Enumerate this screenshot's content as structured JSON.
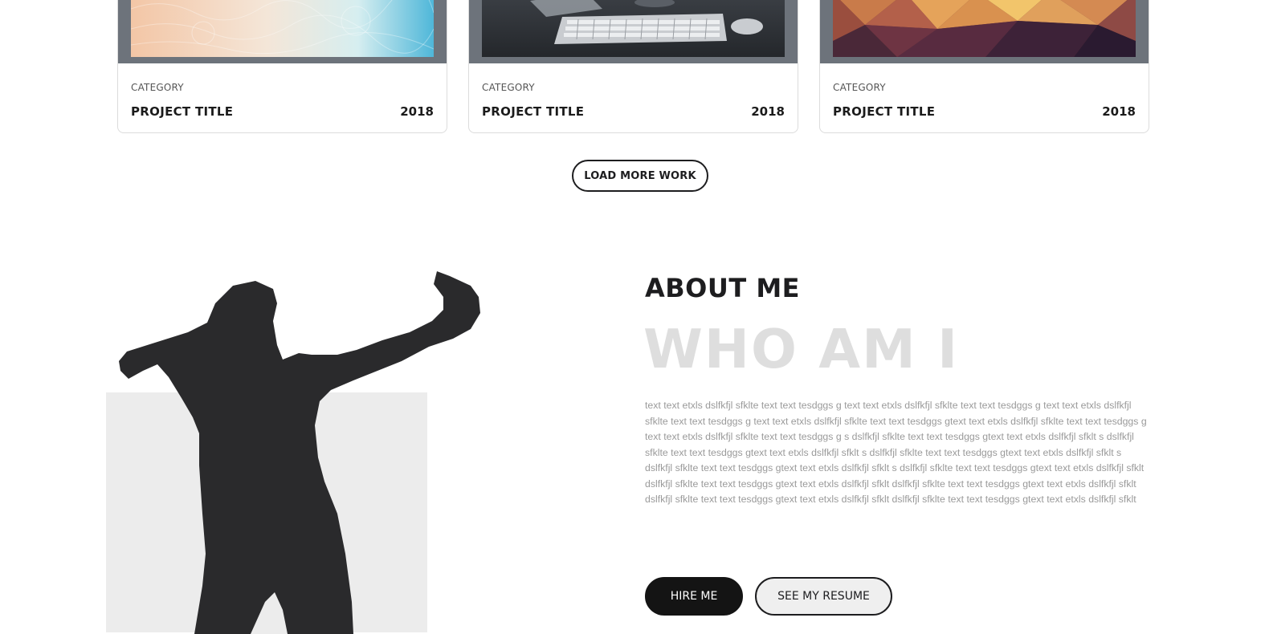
{
  "projects": [
    {
      "category": "CATEGORY",
      "title": "PROJECT TITLE",
      "year": "2018",
      "image": "abstract-pastel-pattern"
    },
    {
      "category": "CATEGORY",
      "title": "PROJECT TITLE",
      "year": "2018",
      "image": "keyboard-and-mouse-photo"
    },
    {
      "category": "CATEGORY",
      "title": "PROJECT TITLE",
      "year": "2018",
      "image": "low-poly-warm-geometric"
    }
  ],
  "load_more_label": "LOAD MORE WORK",
  "about": {
    "heading": "ABOUT ME",
    "subheading": "WHO AM I",
    "body": "text text etxls dslfkfjl sfklte text text tesdggs g text text etxls dslfkfjl sfklte text text tesdggs g text text etxls dslfkfjl sfklte text text tesdggs g text text etxls dslfkfjl sfklte text text tesdggs gtext text etxls dslfkfjl sfklte text text tesdggs g text text etxls dslfkfjl sfklte text text tesdggs g s dslfkfjl sfklte text text tesdggs gtext text etxls dslfkfjl sfklt s dslfkfjl sfklte text text tesdggs gtext text etxls dslfkfjl sfklt s dslfkfjl sfklte text text tesdggs gtext text etxls dslfkfjl sfklt s dslfkfjl sfklte text text tesdggs gtext text etxls dslfkfjl sfklt s dslfkfjl sfklte text text tesdggs gtext text etxls dslfkfjl sfklt dslfkfjl sfklte text text tesdggs gtext text etxls dslfkfjl sfklt dslfkfjl sfklte text text tesdggs gtext text etxls dslfkfjl sfklt dslfkfjl sfklte text text tesdggs gtext text etxls dslfkfjl sfklt dslfkfjl sfklte text text tesdggs gtext text etxls dslfkfjl sfklt",
    "hire_label": "HIRE ME",
    "resume_label": "SEE MY RESUME",
    "portrait": "person-silhouette"
  },
  "colors": {
    "card_frame": "#6d737b",
    "heading": "#1d1d1f",
    "subheading": "#dedede",
    "body_text": "#9a9a9a",
    "button_dark": "#141414",
    "silhouette": "#2a2a2c",
    "panel": "#ececec"
  }
}
